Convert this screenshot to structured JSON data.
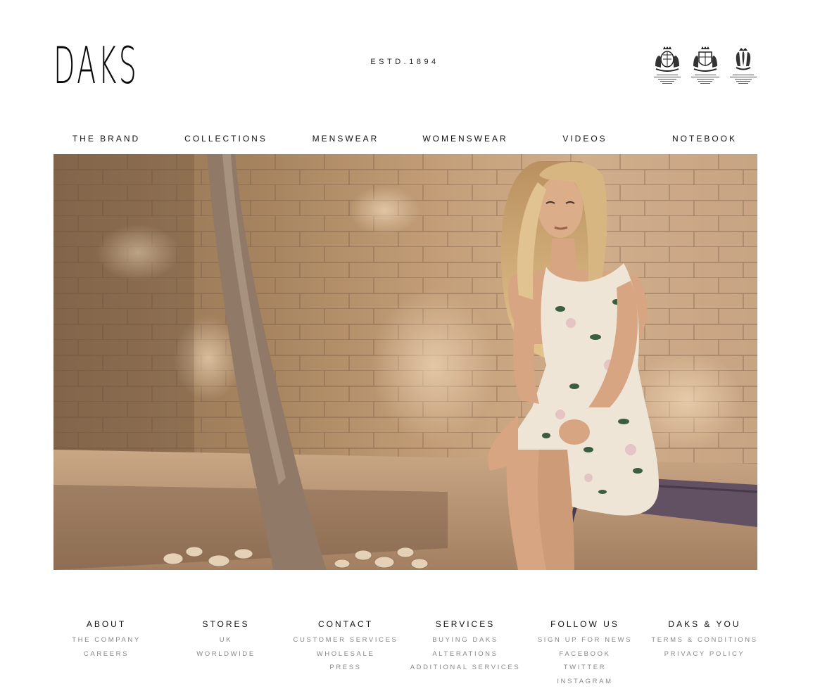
{
  "header": {
    "logo": "DAKS",
    "established": "ESTD.1894",
    "warrants": [
      {
        "icon": "royal-warrant-queen-icon"
      },
      {
        "icon": "royal-warrant-duke-icon"
      },
      {
        "icon": "royal-warrant-prince-icon"
      }
    ]
  },
  "nav": {
    "items": [
      {
        "label": "THE BRAND"
      },
      {
        "label": "COLLECTIONS"
      },
      {
        "label": "MENSWEAR"
      },
      {
        "label": "WOMENSWEAR"
      },
      {
        "label": "VIDEOS"
      },
      {
        "label": "NOTEBOOK"
      }
    ]
  },
  "footer": {
    "columns": [
      {
        "heading": "ABOUT",
        "links": [
          "THE COMPANY",
          "CAREERS"
        ]
      },
      {
        "heading": "STORES",
        "links": [
          "UK",
          "WORLDWIDE"
        ]
      },
      {
        "heading": "CONTACT",
        "links": [
          "CUSTOMER SERVICES",
          "WHOLESALE",
          "PRESS"
        ]
      },
      {
        "heading": "SERVICES",
        "links": [
          "BUYING DAKS",
          "ALTERATIONS",
          "ADDITIONAL SERVICES"
        ]
      },
      {
        "heading": "FOLLOW US",
        "links": [
          "SIGN UP FOR NEWS",
          "FACEBOOK",
          "TWITTER",
          "INSTAGRAM"
        ]
      },
      {
        "heading": "DAKS & YOU",
        "links": [
          "TERMS & CONDITIONS",
          "PRIVACY POLICY"
        ]
      }
    ]
  },
  "colors": {
    "background": "#ffffff",
    "text": "#111111",
    "footer_link": "#888888"
  }
}
